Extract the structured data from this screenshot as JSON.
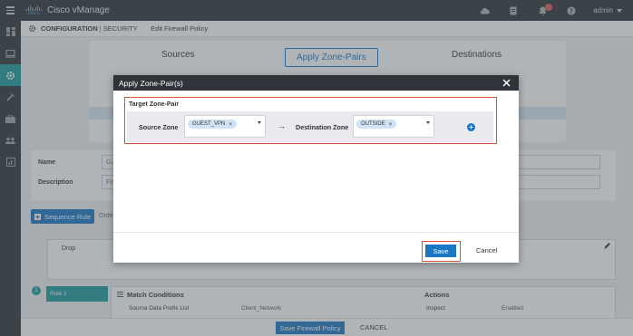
{
  "app": {
    "brand": "cisco",
    "title": "Cisco vManage",
    "user": "admin",
    "notification_badge_color": "#e05a4e"
  },
  "breadcrumb": {
    "section": "CONFIGURATION",
    "subsection": "SECURITY",
    "page": "Edit Firewall Policy"
  },
  "sidebar": {
    "items": [
      "dashboard-icon",
      "monitor-icon",
      "configuration-icon",
      "tools-icon",
      "maintenance-icon",
      "administration-icon",
      "analytics-icon"
    ],
    "active_index": 2,
    "active_color": "#1c9a9b"
  },
  "wizard": {
    "steps": [
      "Sources",
      "Apply Zone-Pairs",
      "Destinations"
    ],
    "active": "Apply Zone-Pairs"
  },
  "form": {
    "name_label": "Name",
    "name_value": "Gu",
    "description_label": "Description",
    "description_value": "Fire"
  },
  "sequence": {
    "button_label": "Sequence Rule",
    "order_label": "Orde"
  },
  "rule": {
    "action": "Drop",
    "number": "1",
    "name": "Rule 1"
  },
  "match": {
    "title": "Match Conditions",
    "row_label": "Source Data Prefix List",
    "row_value": "Client_Network",
    "actions_title": "Actions",
    "action_label": "Inspect",
    "action_value": "Enabled"
  },
  "footer": {
    "save_label": "Save Firewall Policy",
    "cancel_label": "CANCEL"
  },
  "modal": {
    "title": "Apply Zone-Pair(s)",
    "section_title": "Target Zone-Pair",
    "source_label": "Source Zone",
    "source_value": "GUEST_VPN",
    "dest_label": "Destination Zone",
    "dest_value": "OUTSIDE",
    "save_label": "Save",
    "cancel_label": "Cancel",
    "accent": "#1b76c4",
    "highlight": "#d9533b"
  }
}
